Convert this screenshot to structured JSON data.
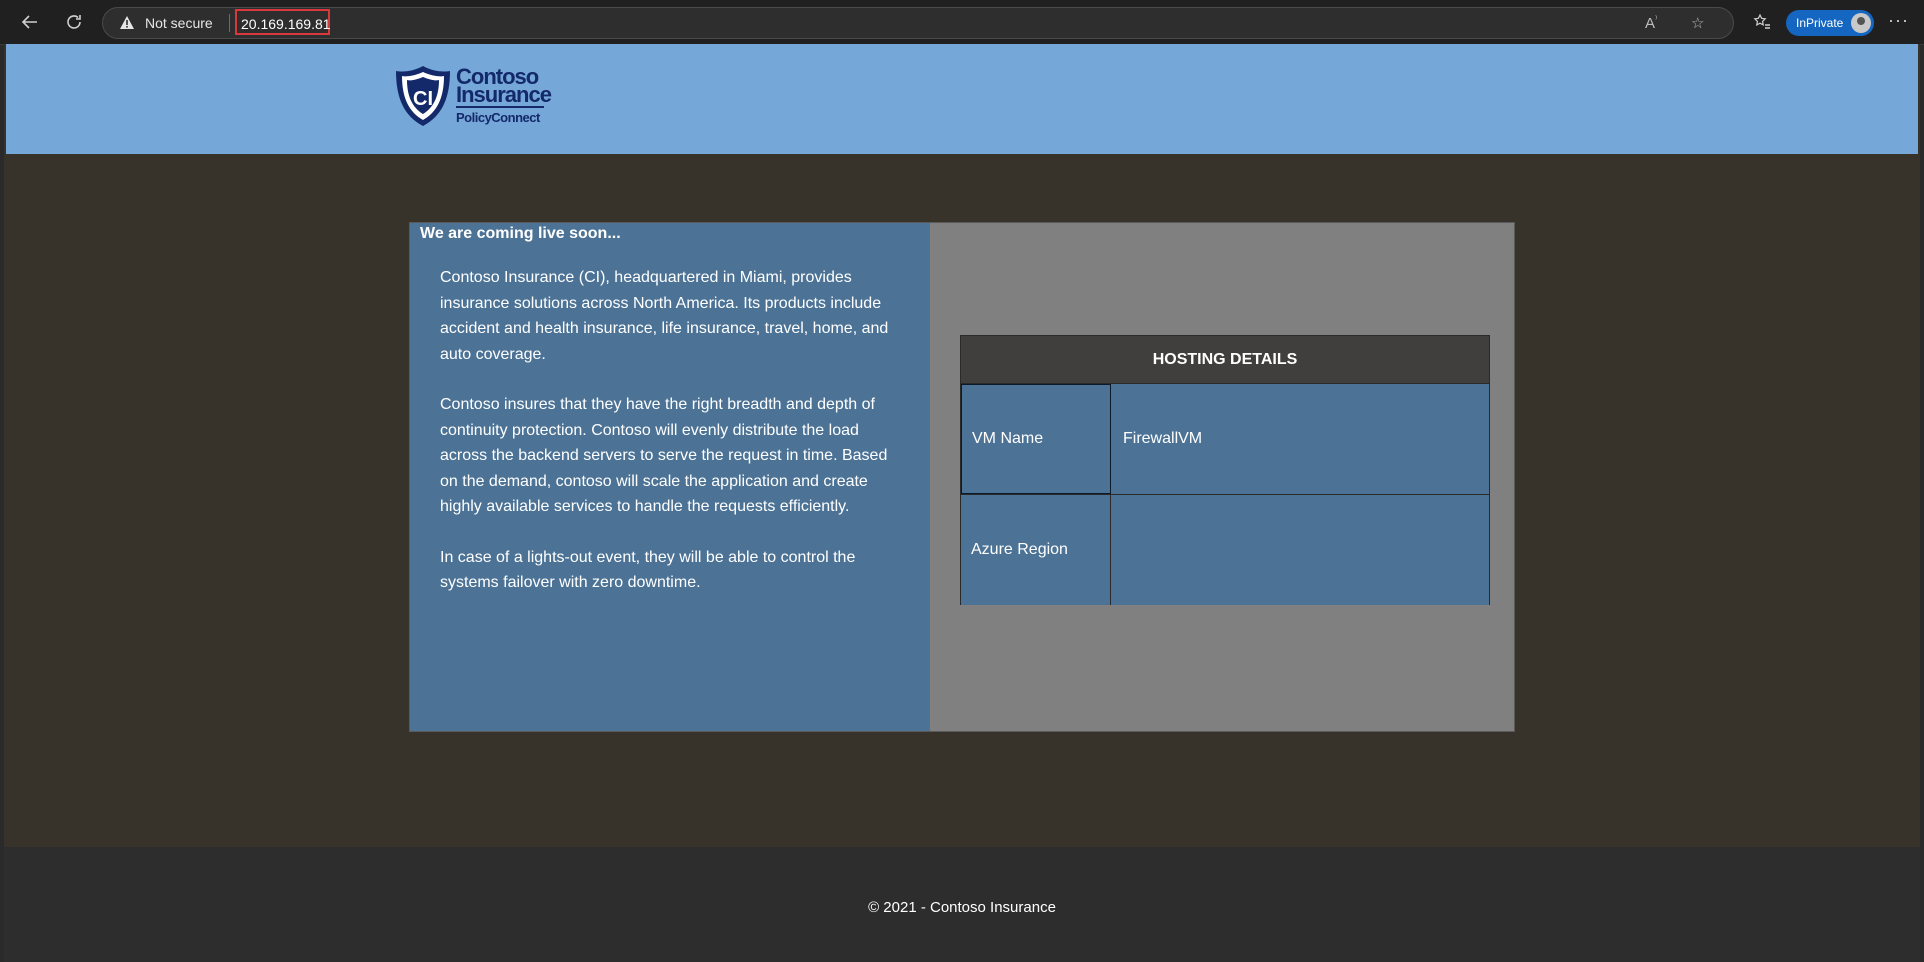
{
  "browser": {
    "security_label": "Not secure",
    "url": "20.169.169.81",
    "inprivate_label": "InPrivate"
  },
  "header": {
    "logo": {
      "monogram": "CI",
      "line1": "Contoso",
      "line2": "Insurance",
      "line3": "PolicyConnect"
    }
  },
  "main": {
    "heading": "We are coming live soon...",
    "paragraphs": [
      "Contoso Insurance (CI), headquartered in Miami, provides insurance solutions across North America. Its products include accident and health insurance, life insurance, travel, home, and auto coverage.",
      "Contoso insures that they have the right breadth and depth of continuity protection. Contoso will evenly distribute the load across the backend servers to serve the request in time. Based on the demand, contoso will scale the application and create highly available services to handle the requests efficiently.",
      "In case of a lights-out event, they will be able to control the systems failover with zero downtime."
    ]
  },
  "hosting": {
    "title": "HOSTING DETAILS",
    "rows": [
      {
        "label": "VM Name",
        "value": "FirewallVM"
      },
      {
        "label": "Azure Region",
        "value": ""
      }
    ]
  },
  "footer": {
    "copyright": "© 2021 - Contoso Insurance"
  },
  "colors": {
    "banner": "#75a7d8",
    "panel_blue": "#4c7396",
    "page_bg": "#37332b",
    "table_header": "#403f3d",
    "url_highlight": "#d9383c"
  }
}
